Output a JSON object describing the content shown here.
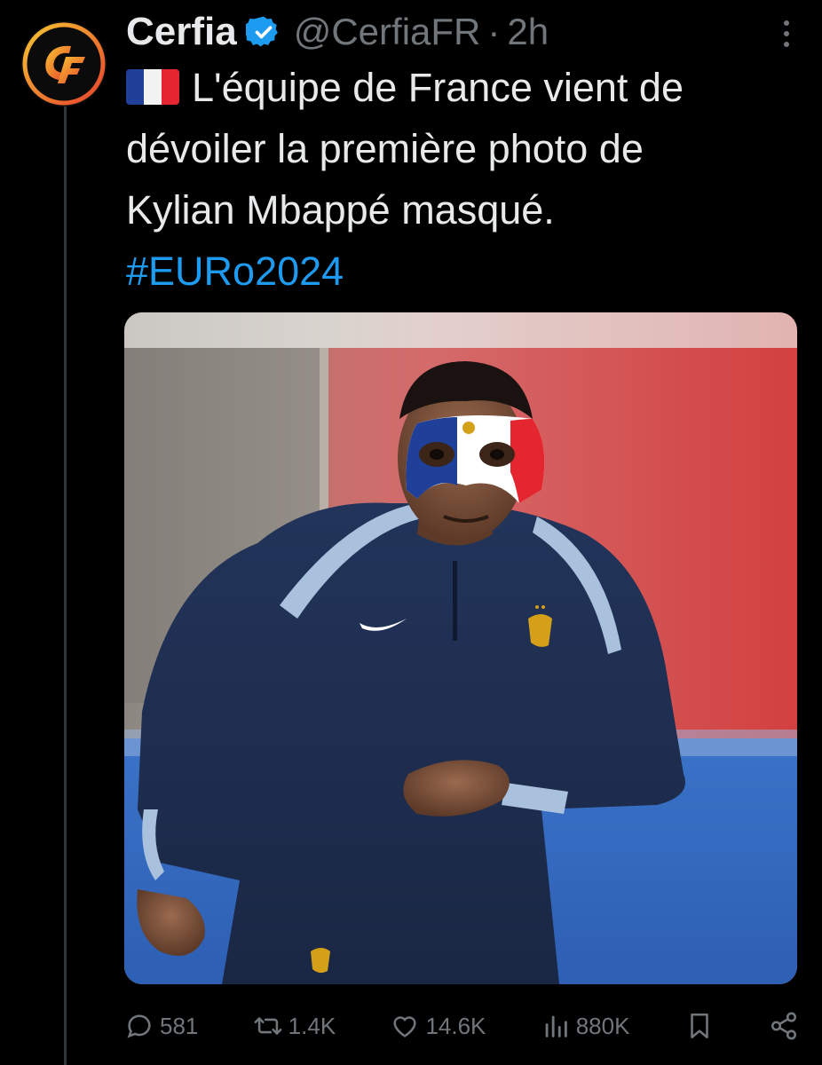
{
  "tweet": {
    "display_name": "Cerfia",
    "verified_icon": "verified-badge-icon",
    "handle": "@CerfiaFR",
    "separator": "·",
    "time": "2h",
    "flag_icon": "france-flag-icon",
    "text_line1": "L'équipe de France vient de",
    "text_line2": "dévoiler la première photo de",
    "text_line3": "Kylian Mbappé masqué.",
    "hashtag": "#EURo2024",
    "avatar_letters": "CF",
    "media_alt": "Kylian Mbappé running in a French national team training top wearing a blue, white and red face mask"
  },
  "actions": {
    "replies": "581",
    "reposts": "1.4K",
    "likes": "14.6K",
    "views": "880K"
  },
  "colors": {
    "background": "#000000",
    "text": "#e7e9ea",
    "muted": "#71767b",
    "link": "#1d9bf0",
    "verified": "#1d9bf0",
    "avatar_orange": "#f5a623",
    "avatar_red": "#e8412c"
  }
}
